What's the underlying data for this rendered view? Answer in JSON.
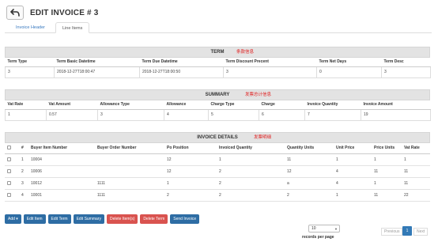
{
  "header": {
    "title": "EDIT INVOICE # 3",
    "back_icon": "arrow-back-icon"
  },
  "tabs": [
    {
      "label": "Invoice Header",
      "active": false
    },
    {
      "label": "Line Items",
      "active": true
    }
  ],
  "term": {
    "title": "TERM",
    "note": "条款信息",
    "columns": [
      "Term Type",
      "Term Basic Datetime",
      "Term Due Datetime",
      "Term Discount Precent",
      "Term Net Days",
      "Term Desc"
    ],
    "row": [
      "3",
      "2018-12-27T18:00:47",
      "2018-12-27T18:00:50",
      "3",
      "0",
      "3"
    ]
  },
  "summary": {
    "title": "SUMMARY",
    "note": "发票总计信息",
    "columns": [
      "Vat Rate",
      "Vat Amount",
      "Allowance Type",
      "Allowance",
      "Charge Type",
      "Charge",
      "Invoice Quantity",
      "Invoice Amount"
    ],
    "row": [
      "1",
      "0.57",
      "3",
      "4",
      "5",
      "6",
      "7",
      "19"
    ]
  },
  "details": {
    "title": "INVOICE DETAILS",
    "note": "发票明细",
    "columns": [
      "#",
      "Buyer Item Number",
      "Buyer Order Number",
      "Po Position",
      "Invoiced Quantity",
      "Quantity Units",
      "Unit Price",
      "Price Units",
      "Vat Rate"
    ],
    "rows": [
      [
        "1",
        "10004",
        "",
        "12",
        "1",
        "11",
        "1",
        "1",
        "1"
      ],
      [
        "2",
        "10006",
        "",
        "12",
        "2",
        "12",
        "4",
        "11",
        "11"
      ],
      [
        "3",
        "10012",
        "1111",
        "1",
        "2",
        "a",
        "4",
        "1",
        "11"
      ],
      [
        "4",
        "10001",
        "1111",
        "2",
        "2",
        "2",
        "1",
        "11",
        "22"
      ]
    ]
  },
  "actions": [
    {
      "label": "Add ▾",
      "color": "#2e6da4"
    },
    {
      "label": "Edit Item",
      "color": "#2e6da4"
    },
    {
      "label": "Edit Term",
      "color": "#2e6da4"
    },
    {
      "label": "Edit Summary",
      "color": "#2e6da4"
    },
    {
      "label": "Delete Item(s)",
      "color": "#d9534f"
    },
    {
      "label": "Delete Term",
      "color": "#d9534f"
    },
    {
      "label": "Send Invoice",
      "color": "#2e6da4"
    }
  ],
  "pager": {
    "page_size": "10",
    "records_label": "records per page",
    "prev_label": "Previous",
    "current_page": "1",
    "next_label": "Next"
  },
  "watermark": "https://blog.csdn.net/Sara_EDI_Consultant"
}
